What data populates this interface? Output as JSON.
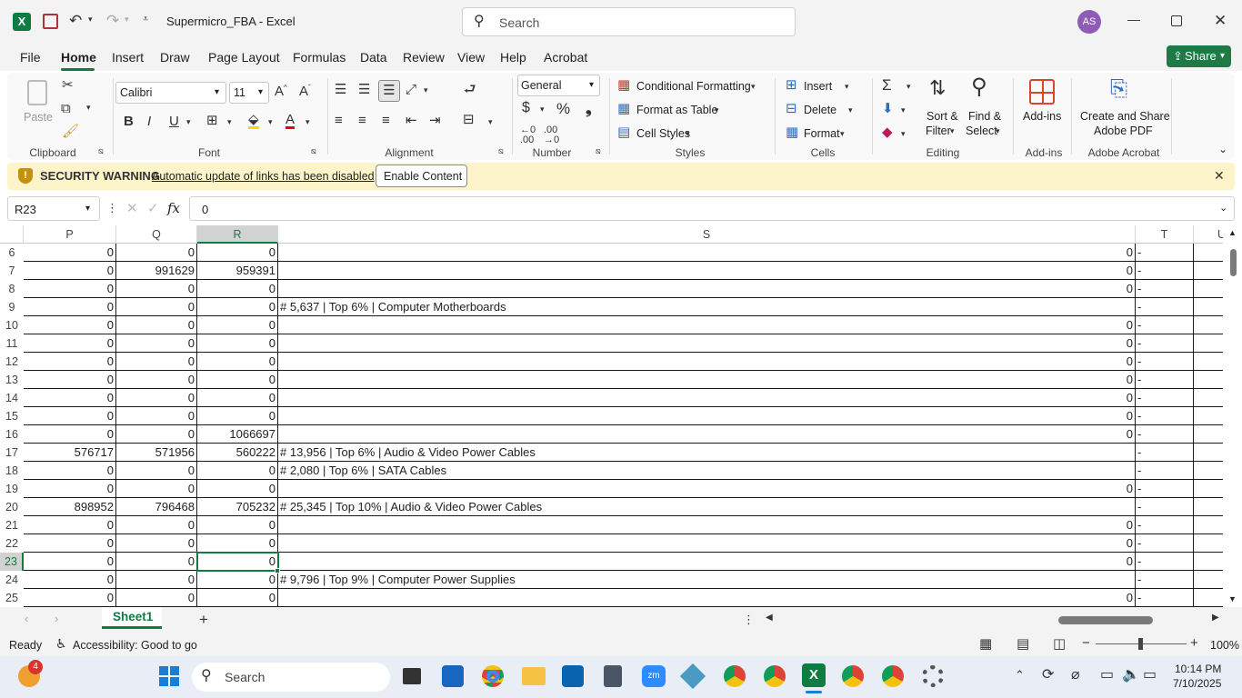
{
  "app": {
    "title": "Supermicro_FBA  -  Excel",
    "search_placeholder": "Search",
    "user_initials": "AS",
    "share_label": "Share"
  },
  "ribbon_tabs": [
    "File",
    "Home",
    "Insert",
    "Draw",
    "Page Layout",
    "Formulas",
    "Data",
    "Review",
    "View",
    "Help",
    "Acrobat"
  ],
  "ribbon": {
    "clipboard": {
      "label": "Clipboard",
      "paste": "Paste"
    },
    "font": {
      "label": "Font",
      "name": "Calibri",
      "size": "11"
    },
    "alignment": {
      "label": "Alignment"
    },
    "number": {
      "label": "Number",
      "format": "General"
    },
    "styles": {
      "label": "Styles",
      "conditional": "Conditional Formatting",
      "format_table": "Format as Table",
      "cell_styles": "Cell Styles"
    },
    "cells": {
      "label": "Cells",
      "insert": "Insert",
      "delete": "Delete",
      "format": "Format"
    },
    "editing": {
      "label": "Editing",
      "sort1": "Sort &",
      "sort2": "Filter",
      "find1": "Find &",
      "find2": "Select"
    },
    "addins": {
      "label": "Add-ins",
      "button": "Add-ins"
    },
    "acrobat": {
      "label": "Adobe Acrobat",
      "line1": "Create and Share",
      "line2": "Adobe PDF"
    }
  },
  "security": {
    "title": "SECURITY WARNING",
    "message": "Automatic update of links has been disabled",
    "button": "Enable Content"
  },
  "formula_bar": {
    "name_box": "R23",
    "value": "0"
  },
  "columns": [
    {
      "id": "P"
    },
    {
      "id": "Q"
    },
    {
      "id": "R"
    },
    {
      "id": "S"
    },
    {
      "id": "T"
    },
    {
      "id": "U"
    }
  ],
  "rows": [
    {
      "n": "6",
      "p": "0",
      "q": "0",
      "r": "0",
      "s": "",
      "s2": "0",
      "t": "-"
    },
    {
      "n": "7",
      "p": "0",
      "q": "991629",
      "r": "959391",
      "s": "",
      "s2": "0",
      "t": "-"
    },
    {
      "n": "8",
      "p": "0",
      "q": "0",
      "r": "0",
      "s": "",
      "s2": "0",
      "t": "-"
    },
    {
      "n": "9",
      "p": "0",
      "q": "0",
      "r": "0",
      "s": "# 5,637 | Top 6% | Computer Motherboards",
      "s2": "",
      "t": "-"
    },
    {
      "n": "10",
      "p": "0",
      "q": "0",
      "r": "0",
      "s": "",
      "s2": "0",
      "t": "-"
    },
    {
      "n": "11",
      "p": "0",
      "q": "0",
      "r": "0",
      "s": "",
      "s2": "0",
      "t": "-"
    },
    {
      "n": "12",
      "p": "0",
      "q": "0",
      "r": "0",
      "s": "",
      "s2": "0",
      "t": "-"
    },
    {
      "n": "13",
      "p": "0",
      "q": "0",
      "r": "0",
      "s": "",
      "s2": "0",
      "t": "-"
    },
    {
      "n": "14",
      "p": "0",
      "q": "0",
      "r": "0",
      "s": "",
      "s2": "0",
      "t": "-"
    },
    {
      "n": "15",
      "p": "0",
      "q": "0",
      "r": "0",
      "s": "",
      "s2": "0",
      "t": "-"
    },
    {
      "n": "16",
      "p": "0",
      "q": "0",
      "r": "1066697",
      "s": "",
      "s2": "0",
      "t": "-"
    },
    {
      "n": "17",
      "p": "576717",
      "q": "571956",
      "r": "560222",
      "s": "# 13,956 | Top 6% | Audio & Video Power Cables",
      "s2": "",
      "t": "-"
    },
    {
      "n": "18",
      "p": "0",
      "q": "0",
      "r": "0",
      "s": "# 2,080 | Top 6% | SATA Cables",
      "s2": "",
      "t": "-"
    },
    {
      "n": "19",
      "p": "0",
      "q": "0",
      "r": "0",
      "s": "",
      "s2": "0",
      "t": "-"
    },
    {
      "n": "20",
      "p": "898952",
      "q": "796468",
      "r": "705232",
      "s": "# 25,345 | Top 10% | Audio & Video Power Cables",
      "s2": "",
      "t": "-"
    },
    {
      "n": "21",
      "p": "0",
      "q": "0",
      "r": "0",
      "s": "",
      "s2": "0",
      "t": "-"
    },
    {
      "n": "22",
      "p": "0",
      "q": "0",
      "r": "0",
      "s": "",
      "s2": "0",
      "t": "-"
    },
    {
      "n": "23",
      "p": "0",
      "q": "0",
      "r": "0",
      "s": "",
      "s2": "0",
      "t": "-"
    },
    {
      "n": "24",
      "p": "0",
      "q": "0",
      "r": "0",
      "s": "# 9,796 | Top 9% | Computer Power Supplies",
      "s2": "",
      "t": "-"
    },
    {
      "n": "25",
      "p": "0",
      "q": "0",
      "r": "0",
      "s": "",
      "s2": "0",
      "t": "-"
    }
  ],
  "sheet_tabs": [
    "Sheet1"
  ],
  "status": {
    "ready": "Ready",
    "accessibility": "Accessibility: Good to go",
    "zoom": "100%"
  },
  "taskbar": {
    "search": "Search",
    "time": "10:14 PM",
    "date": "7/10/2025",
    "badge": "4"
  },
  "colors": {
    "excel_green": "#217346",
    "share_green": "#1e7b45",
    "warning_bg": "#fdf5c9",
    "selection": "#107c41"
  }
}
